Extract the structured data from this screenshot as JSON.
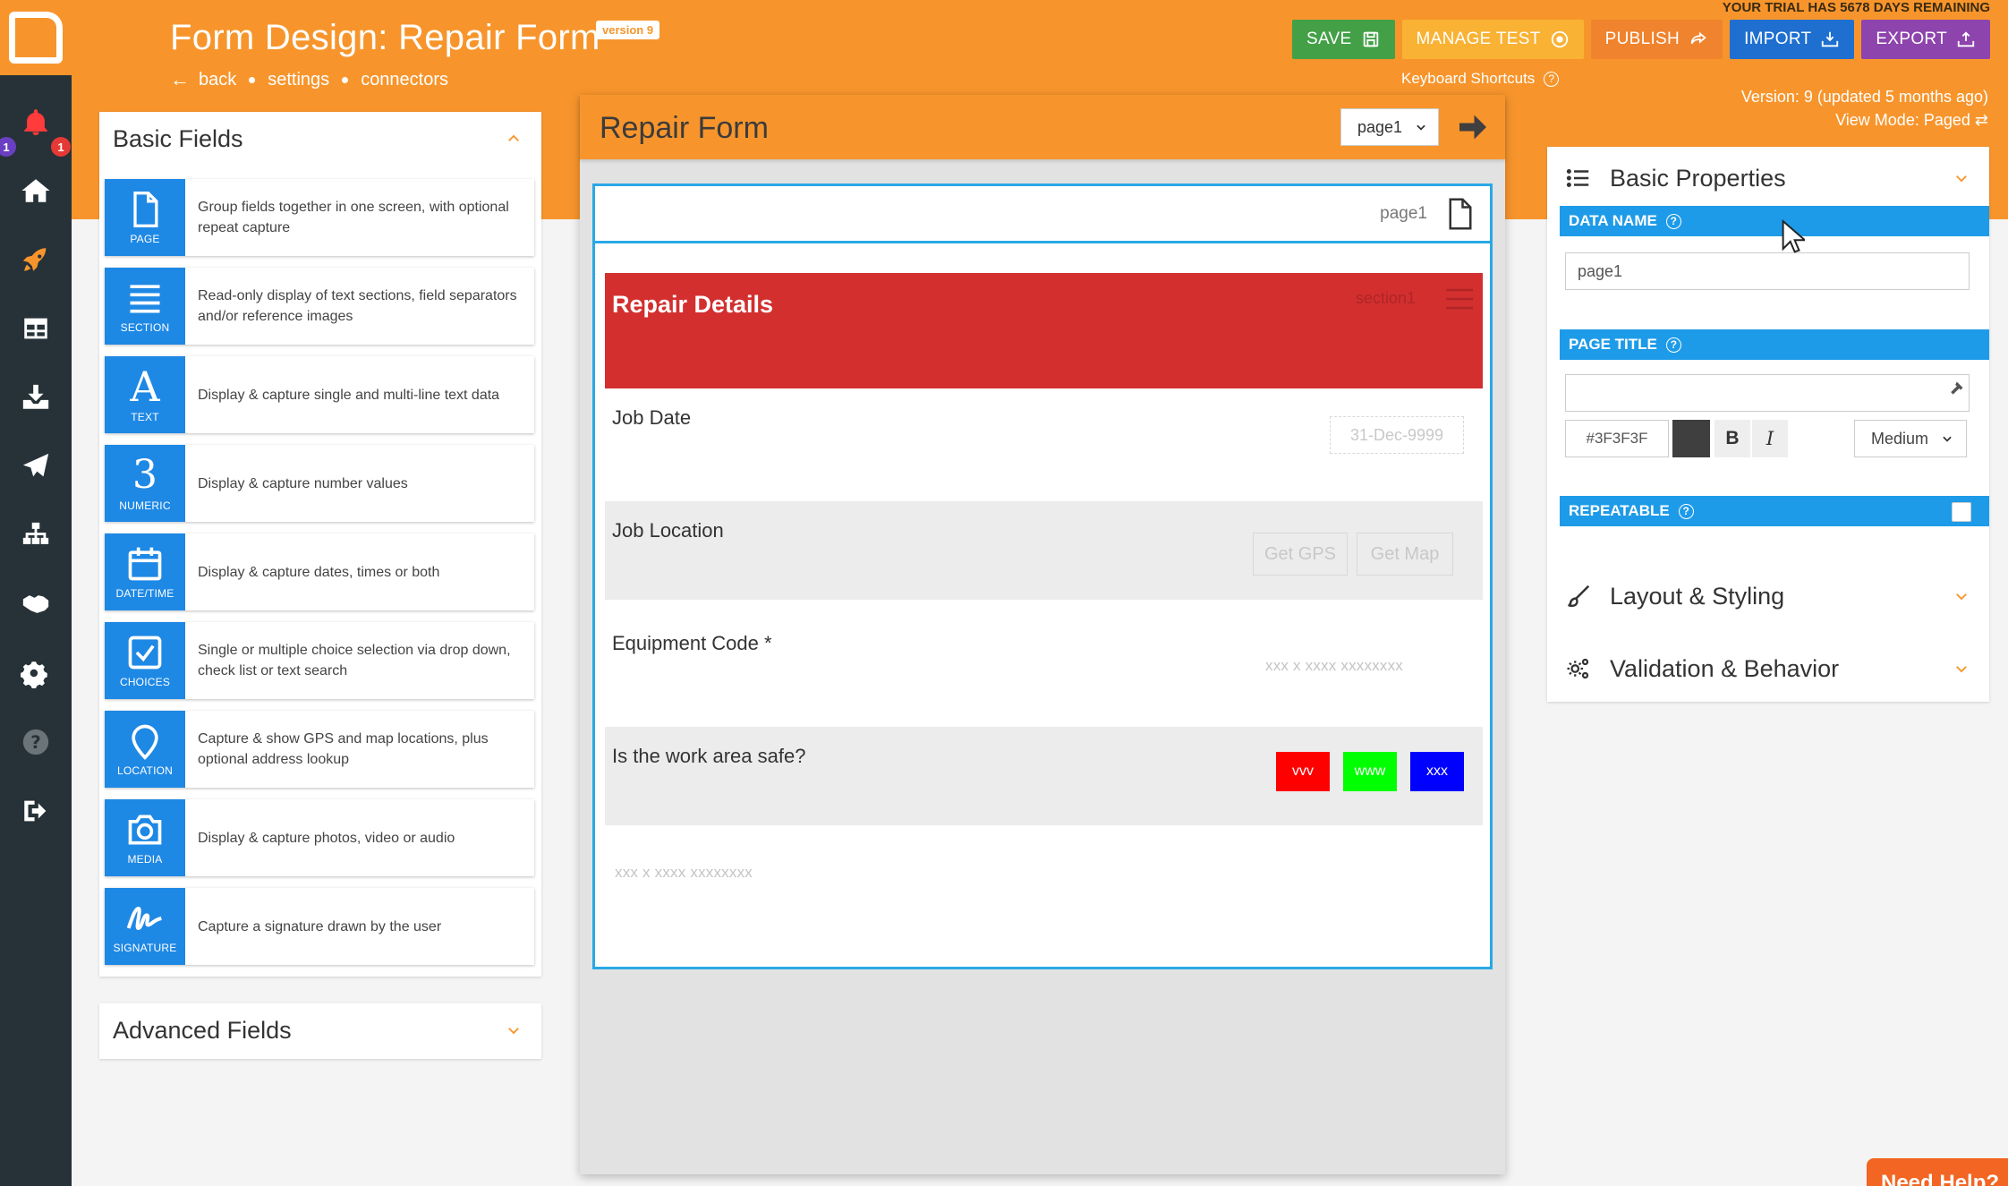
{
  "nav": {
    "badges": {
      "left": "1",
      "right": "1"
    },
    "items": [
      {
        "icon": "bell-icon"
      },
      {
        "icon": "home-icon"
      },
      {
        "icon": "rocket-icon"
      },
      {
        "icon": "table-icon"
      },
      {
        "icon": "inbox-download-icon"
      },
      {
        "icon": "paper-plane-icon"
      },
      {
        "icon": "sitemap-icon"
      },
      {
        "icon": "handshake-icon"
      },
      {
        "icon": "cogs-icon"
      },
      {
        "icon": "help-circle-icon"
      },
      {
        "icon": "sign-out-icon"
      }
    ]
  },
  "header": {
    "title": "Form Design: Repair Form",
    "version_badge": "version 9",
    "links": {
      "back": "back",
      "settings": "settings",
      "connectors": "connectors"
    },
    "trial": "YOUR TRIAL HAS 5678 DAYS REMAINING",
    "keyboard_shortcuts": "Keyboard Shortcuts",
    "version_info": "Version: 9 (updated 5 months ago)",
    "view_mode": "View Mode: Paged",
    "buttons": {
      "save": "SAVE",
      "manage_test": "MANAGE TEST",
      "publish": "PUBLISH",
      "import": "IMPORT",
      "export": "EXPORT"
    },
    "colors": {
      "save": "#43a047",
      "manage_test": "#f9b233",
      "publish": "#f0832d",
      "import": "#1e6fd0",
      "export": "#8e44ad"
    }
  },
  "basic_fields": {
    "title": "Basic Fields",
    "items": [
      {
        "label": "PAGE",
        "desc": "Group fields together in one screen, with optional repeat capture"
      },
      {
        "label": "SECTION",
        "desc": "Read-only display of text sections, field separators and/or reference images"
      },
      {
        "label": "TEXT",
        "desc": "Display & capture single and multi-line text data"
      },
      {
        "label": "NUMERIC",
        "desc": "Display & capture number values"
      },
      {
        "label": "DATE/TIME",
        "desc": "Display & capture dates, times or both"
      },
      {
        "label": "CHOICES",
        "desc": "Single or multiple choice selection via drop down, check list or text search"
      },
      {
        "label": "LOCATION",
        "desc": "Capture & show GPS and map locations, plus optional address lookup"
      },
      {
        "label": "MEDIA",
        "desc": "Display & capture photos, video or audio"
      },
      {
        "label": "SIGNATURE",
        "desc": "Capture a signature drawn by the user"
      }
    ],
    "text_glyph": "A",
    "numeric_glyph": "3"
  },
  "advanced_fields": {
    "title": "Advanced Fields"
  },
  "canvas": {
    "title": "Repair Form",
    "page_select": "page1",
    "page_name": "page1",
    "section": {
      "title": "Repair Details",
      "name": "section1"
    },
    "fields": {
      "job_date": {
        "label": "Job Date",
        "placeholder": "31-Dec-9999"
      },
      "job_location": {
        "label": "Job Location",
        "get_gps": "Get GPS",
        "get_map": "Get Map"
      },
      "equipment_code": {
        "label": "Equipment Code *",
        "placeholder": "xxx x xxxx xxxxxxxx"
      },
      "work_area_safe": {
        "label": "Is the work area safe?",
        "options": [
          "vvv",
          "www",
          "xxx"
        ]
      },
      "extra_placeholder": "xxx x xxxx xxxxxxxx"
    },
    "chip_colors": [
      "#ff0000",
      "#00ff00",
      "#0000ff"
    ]
  },
  "properties": {
    "basic_title": "Basic Properties",
    "data_name_label": "DATA NAME",
    "data_name_value": "page1",
    "page_title_label": "PAGE TITLE",
    "page_title_value": "",
    "color_value": "#3F3F3F",
    "bold": "B",
    "italic": "I",
    "size": "Medium",
    "repeatable_label": "REPEATABLE",
    "layout_title": "Layout & Styling",
    "validation_title": "Validation & Behavior"
  },
  "help_button": "Need Help?"
}
